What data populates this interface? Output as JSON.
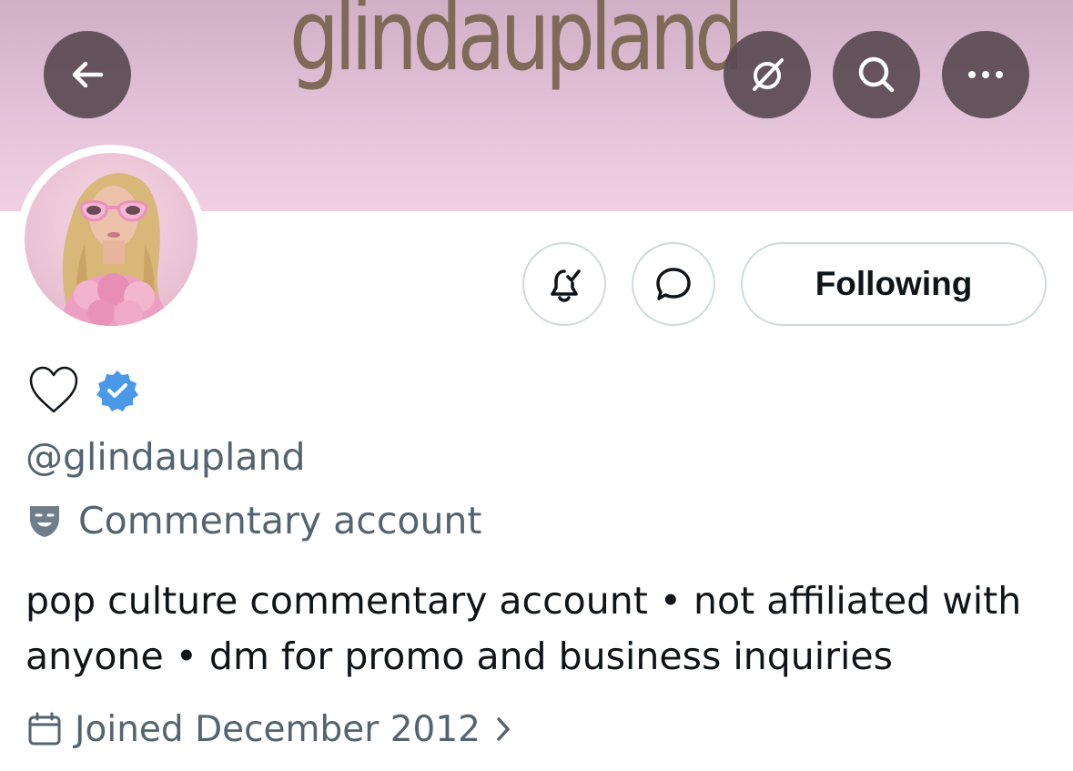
{
  "banner": {
    "text": "glindaupland"
  },
  "header": {
    "back_icon": "arrow-left-icon",
    "grok_icon": "grok-icon",
    "search_icon": "search-icon",
    "more_icon": "more-horizontal-icon"
  },
  "actions": {
    "notify_icon": "bell-check-icon",
    "message_icon": "message-bubble-icon",
    "following_label": "Following"
  },
  "profile": {
    "display_name_icon": "heart-outline-icon",
    "verified_icon": "verified-badge-icon",
    "handle": "@glindaupland",
    "label_icon": "theater-mask-icon",
    "label_text": "Commentary account",
    "bio_line1": "pop culture commentary account • not affiliated with",
    "bio_line2": "anyone • dm for promo and business inquiries",
    "joined_icon": "calendar-icon",
    "joined_text": "Joined December 2012"
  },
  "colors": {
    "verified": "#4a99e9",
    "secondary_text": "#536471",
    "border": "#cfd9de"
  }
}
